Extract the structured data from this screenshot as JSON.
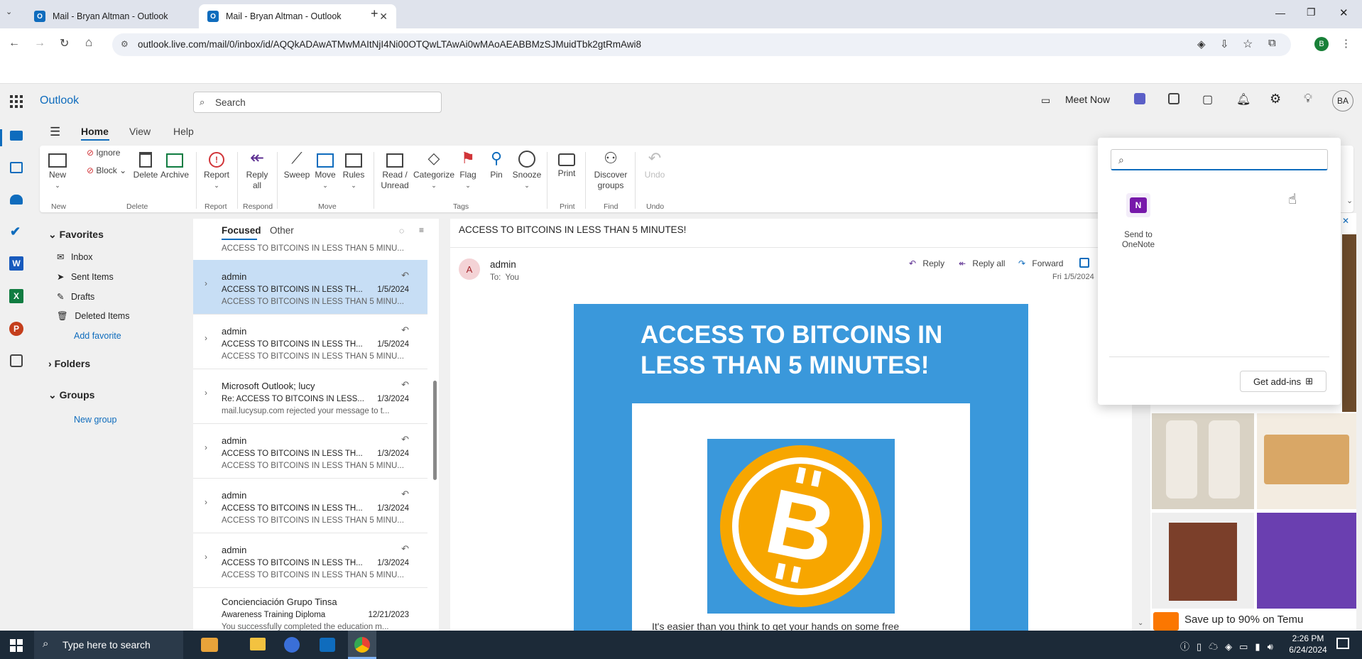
{
  "browser": {
    "tabs": [
      {
        "title": "Mail - Bryan Altman - Outlook"
      },
      {
        "title": "Mail - Bryan Altman - Outlook"
      }
    ],
    "url": "outlook.live.com/mail/0/inbox/id/AQQkADAwATMwMAItNjI4Ni00OTQwLTAwAi0wMAoAEABBMzSJMuidTbk2gtRmAwi8",
    "profile": "B"
  },
  "outlook": {
    "app_name": "Outlook",
    "search_placeholder": "Search",
    "meet_now": "Meet Now",
    "avatar": "BA",
    "ribbon_tabs": [
      "Home",
      "View",
      "Help"
    ],
    "ribbon": {
      "new": "New",
      "ignore": "Ignore",
      "block": "Block",
      "delete": "Delete",
      "archive": "Archive",
      "report": "Report",
      "reply_all": "Reply\nall",
      "sweep": "Sweep",
      "move": "Move",
      "rules": "Rules",
      "read_unread": "Read /\nUnread",
      "categorize": "Categorize",
      "flag": "Flag",
      "pin": "Pin",
      "snooze": "Snooze",
      "print": "Print",
      "discover": "Discover\ngroups",
      "undo": "Undo",
      "groups": [
        "New",
        "Delete",
        "Report",
        "Respond",
        "Move",
        "Tags",
        "Print",
        "Find",
        "Undo"
      ]
    },
    "folders": {
      "favorites": "Favorites",
      "items": [
        "Inbox",
        "Sent Items",
        "Drafts",
        "Deleted Items"
      ],
      "add_favorite": "Add favorite",
      "folders": "Folders",
      "groups": "Groups",
      "new_group": "New group"
    },
    "list": {
      "focused": "Focused",
      "other": "Other",
      "partial": "ACCESS TO BITCOINS IN LESS THAN 5 MINU...",
      "messages": [
        {
          "sender": "admin",
          "subject": "ACCESS TO BITCOINS IN LESS TH...",
          "date": "1/5/2024",
          "preview": "ACCESS TO BITCOINS IN LESS THAN 5 MINU..."
        },
        {
          "sender": "admin",
          "subject": "ACCESS TO BITCOINS IN LESS TH...",
          "date": "1/5/2024",
          "preview": "ACCESS TO BITCOINS IN LESS THAN 5 MINU..."
        },
        {
          "sender": "Microsoft Outlook; lucy",
          "subject": "Re: ACCESS TO BITCOINS IN LESS...",
          "date": "1/3/2024",
          "preview": "mail.lucysup.com rejected your message to t..."
        },
        {
          "sender": "admin",
          "subject": "ACCESS TO BITCOINS IN LESS TH...",
          "date": "1/3/2024",
          "preview": "ACCESS TO BITCOINS IN LESS THAN 5 MINU..."
        },
        {
          "sender": "admin",
          "subject": "ACCESS TO BITCOINS IN LESS TH...",
          "date": "1/3/2024",
          "preview": "ACCESS TO BITCOINS IN LESS THAN 5 MINU..."
        },
        {
          "sender": "admin",
          "subject": "ACCESS TO BITCOINS IN LESS TH...",
          "date": "1/3/2024",
          "preview": "ACCESS TO BITCOINS IN LESS THAN 5 MINU..."
        },
        {
          "sender": "Concienciación Grupo Tinsa",
          "subject": "Awareness Training Diploma",
          "date": "12/21/2023",
          "preview": "You successfully completed the education m..."
        }
      ]
    },
    "reading": {
      "subject": "ACCESS TO BITCOINS IN LESS THAN 5 MINUTES!",
      "sender": "admin",
      "avatar": "A",
      "to": "To:  You",
      "reply": "Reply",
      "reply_all": "Reply all",
      "forward": "Forward",
      "date": "Fri 1/5/2024",
      "body_title": "ACCESS TO BITCOINS IN LESS THAN 5 MINUTES!",
      "body_text": "It's easier than you think to get your hands on some free"
    },
    "addins": {
      "search_value": "",
      "item": "Send to OneNote",
      "get": "Get add-ins"
    },
    "ad": {
      "text": "Save up to 90% on Temu"
    }
  },
  "taskbar": {
    "search": "Type here to search",
    "time": "2:26 PM",
    "date": "6/24/2024"
  },
  "colors": {
    "accent": "#0f6cbd",
    "email_bg": "#3a98db",
    "btc": "#f7a600"
  }
}
